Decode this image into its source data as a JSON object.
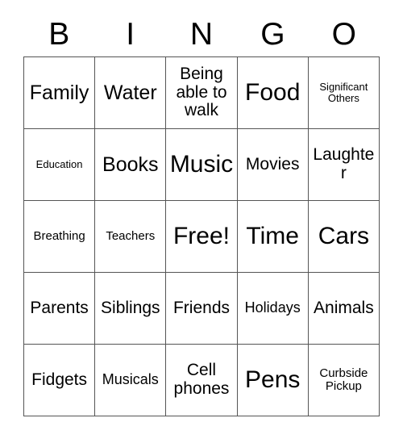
{
  "card": {
    "header_letters": [
      "B",
      "I",
      "N",
      "G",
      "O"
    ],
    "columns": 5,
    "rows": 5,
    "free_space_label": "Free!",
    "colors": {
      "background": "#ffffff",
      "grid_line": "#555555",
      "text": "#000000"
    },
    "cells": [
      [
        {
          "label": "Family",
          "size": "lg"
        },
        {
          "label": "Water",
          "size": "lg"
        },
        {
          "label": "Being able to walk",
          "size": "md"
        },
        {
          "label": "Food",
          "size": "xl"
        },
        {
          "label": "Significant Others",
          "size": "xxs"
        }
      ],
      [
        {
          "label": "Education",
          "size": "xxs"
        },
        {
          "label": "Books",
          "size": "lg"
        },
        {
          "label": "Music",
          "size": "xl"
        },
        {
          "label": "Movies",
          "size": "md"
        },
        {
          "label": "Laughter",
          "size": "md"
        }
      ],
      [
        {
          "label": "Breathing",
          "size": "xs"
        },
        {
          "label": "Teachers",
          "size": "xs"
        },
        {
          "label": "Free!",
          "size": "xl"
        },
        {
          "label": "Time",
          "size": "xl"
        },
        {
          "label": "Cars",
          "size": "xl"
        }
      ],
      [
        {
          "label": "Parents",
          "size": "md"
        },
        {
          "label": "Siblings",
          "size": "md"
        },
        {
          "label": "Friends",
          "size": "md"
        },
        {
          "label": "Holidays",
          "size": "sm"
        },
        {
          "label": "Animals",
          "size": "md"
        }
      ],
      [
        {
          "label": "Fidgets",
          "size": "md"
        },
        {
          "label": "Musicals",
          "size": "sm"
        },
        {
          "label": "Cell phones",
          "size": "md"
        },
        {
          "label": "Pens",
          "size": "xl"
        },
        {
          "label": "Curbside Pickup",
          "size": "xs"
        }
      ]
    ]
  }
}
